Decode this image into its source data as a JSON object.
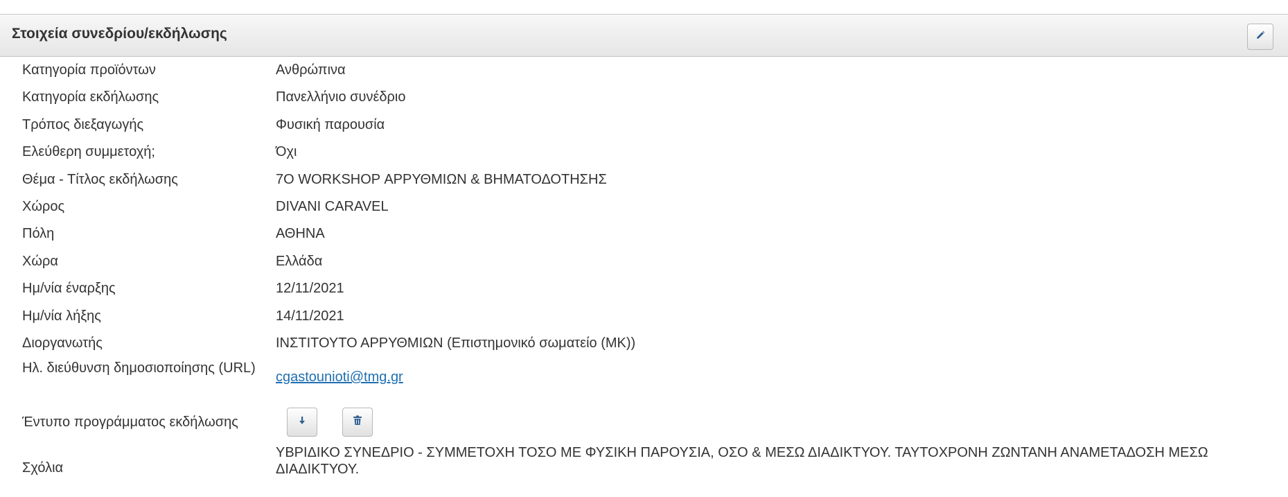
{
  "panel": {
    "title": "Στοιχεία συνεδρίου/εκδήλωσης",
    "edit_icon": "pencil-icon"
  },
  "fields": [
    {
      "label": "Κατηγορία προϊόντων",
      "value": "Ανθρώπινα"
    },
    {
      "label": "Κατηγορία εκδήλωσης",
      "value": "Πανελλήνιο συνέδριο"
    },
    {
      "label": "Τρόπος διεξαγωγής",
      "value": "Φυσική παρουσία"
    },
    {
      "label": "Ελεύθερη συμμετοχή;",
      "value": "Όχι"
    },
    {
      "label": "Θέμα - Τίτλος εκδήλωσης",
      "value": "7Ο WORKSHOP ΑΡΡΥΘΜΙΩΝ & ΒΗΜΑΤΟΔΟΤΗΣΗΣ"
    },
    {
      "label": "Χώρος",
      "value": "DIVANI CARAVEL"
    },
    {
      "label": "Πόλη",
      "value": "ΑΘΗΝΑ"
    },
    {
      "label": "Χώρα",
      "value": "Ελλάδα"
    },
    {
      "label": "Ημ/νία έναρξης",
      "value": "12/11/2021"
    },
    {
      "label": "Ημ/νία λήξης",
      "value": "14/11/2021"
    },
    {
      "label": "Διοργανωτής",
      "value": "ΙΝΣΤΙΤΟΥΤΟ ΑΡΡΥΘΜΙΩΝ (Επιστημονικό σωματείο (ΜΚ))"
    }
  ],
  "url_field": {
    "label": "Ηλ. διεύθυνση δημοσιοποίησης (URL)",
    "value": "cgastounioti@tmg.gr"
  },
  "program_field": {
    "label": "Έντυπο προγράμματος εκδήλωσης",
    "download_icon": "download-icon",
    "delete_icon": "trash-icon"
  },
  "comments_field": {
    "label": "Σχόλια",
    "value": "ΥΒΡΙΔΙΚΟ ΣΥΝΕΔΡΙΟ - ΣΥΜΜΕΤΟΧΗ ΤΟΣΟ ΜΕ ΦΥΣΙΚΗ ΠΑΡΟΥΣΙΑ, ΟΣΟ & ΜΕΣΩ ΔΙΑΔΙΚΤΥΟΥ. ΤΑΥΤΟΧΡΟΝΗ ΖΩΝΤΑΝΗ ΑΝΑΜΕΤΑΔΟΣΗ ΜΕΣΩ ΔΙΑΔΙΚΤΥΟΥ."
  }
}
